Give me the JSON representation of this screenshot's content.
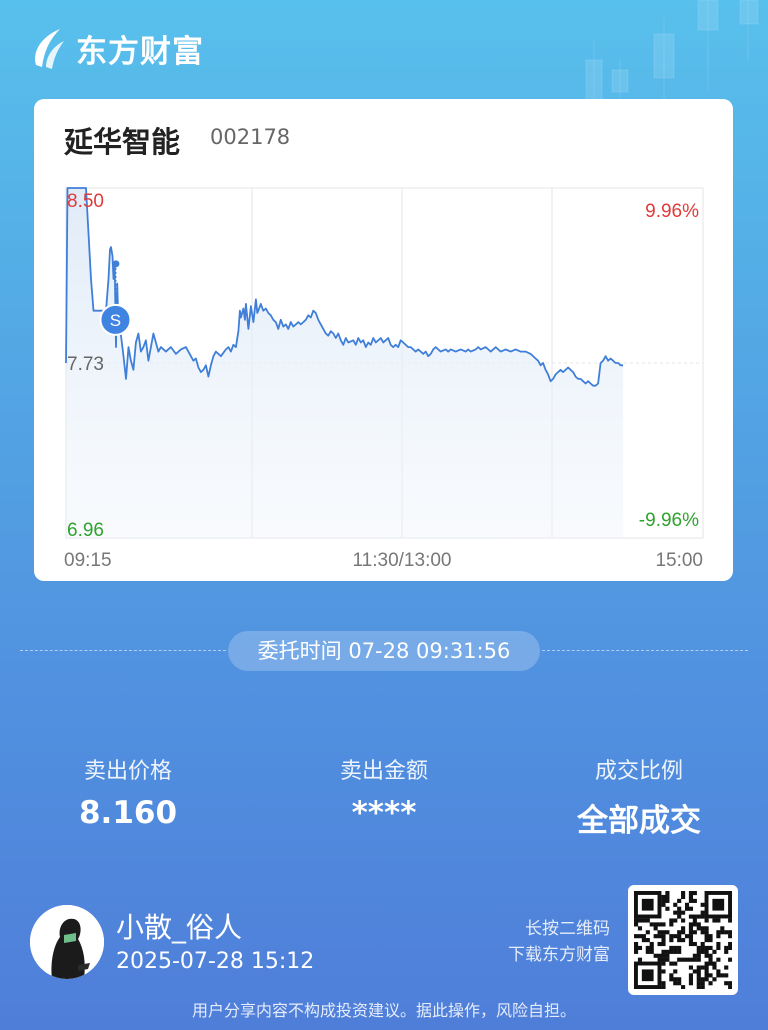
{
  "brand": {
    "name": "东方财富",
    "logo_icon": "eastmoney-logo-icon"
  },
  "stock": {
    "name": "延华智能",
    "code": "002178"
  },
  "chart_data": {
    "type": "line",
    "price_high": "8.50",
    "price_ref": "7.73",
    "price_low": "6.96",
    "pct_high": "9.96%",
    "pct_low": "-9.96%",
    "x_labels": [
      "09:15",
      "11:30/13:00",
      "15:00"
    ],
    "marker_label": "S",
    "ylim": [
      6.96,
      8.5
    ],
    "x_range_minutes": [
      0,
      255
    ],
    "up_color": "#e03b3b",
    "down_color": "#2fa32f",
    "line_color": "#3f7fd8",
    "price_series": [
      [
        0,
        7.73
      ],
      [
        0.6,
        8.5
      ],
      [
        2,
        8.5
      ],
      [
        5,
        8.5
      ],
      [
        8,
        8.5
      ],
      [
        9,
        8.3
      ],
      [
        10,
        8.1
      ],
      [
        11,
        7.96
      ],
      [
        12,
        7.96
      ],
      [
        14,
        7.96
      ],
      [
        15,
        7.96
      ],
      [
        16,
        7.96
      ],
      [
        17,
        8.1
      ],
      [
        17.6,
        8.23
      ],
      [
        18,
        8.24
      ],
      [
        18.6,
        8.2
      ],
      [
        19,
        8.1
      ],
      [
        19.5,
        8.16
      ],
      [
        20,
        7.8
      ],
      [
        20.5,
        8.08
      ],
      [
        21,
        7.9
      ],
      [
        22,
        7.85
      ],
      [
        23,
        7.76
      ],
      [
        24,
        7.66
      ],
      [
        25,
        7.8
      ],
      [
        26,
        7.74
      ],
      [
        27,
        7.7
      ],
      [
        28,
        7.82
      ],
      [
        29,
        7.86
      ],
      [
        30,
        7.78
      ],
      [
        31,
        7.8
      ],
      [
        32,
        7.83
      ],
      [
        33,
        7.74
      ],
      [
        35,
        7.86
      ],
      [
        37,
        7.78
      ],
      [
        38,
        7.8
      ],
      [
        40,
        7.78
      ],
      [
        42,
        7.8
      ],
      [
        44,
        7.77
      ],
      [
        46,
        7.79
      ],
      [
        48,
        7.8
      ],
      [
        49,
        7.78
      ],
      [
        50,
        7.76
      ],
      [
        51,
        7.74
      ],
      [
        52,
        7.75
      ],
      [
        53,
        7.71
      ],
      [
        54,
        7.69
      ],
      [
        55,
        7.7
      ],
      [
        56,
        7.72
      ],
      [
        57,
        7.67
      ],
      [
        58,
        7.72
      ],
      [
        59,
        7.76
      ],
      [
        60,
        7.78
      ],
      [
        62,
        7.76
      ],
      [
        64,
        7.79
      ],
      [
        65,
        7.8
      ],
      [
        66,
        7.78
      ],
      [
        67,
        7.81
      ],
      [
        68,
        7.8
      ],
      [
        69,
        7.87
      ],
      [
        69.6,
        7.96
      ],
      [
        70,
        7.93
      ],
      [
        71,
        7.97
      ],
      [
        71.6,
        7.92
      ],
      [
        72,
        7.99
      ],
      [
        73,
        7.88
      ],
      [
        74,
        7.98
      ],
      [
        75,
        7.91
      ],
      [
        76,
        8.01
      ],
      [
        76.6,
        7.95
      ],
      [
        77,
        7.96
      ],
      [
        78,
        7.99
      ],
      [
        79,
        7.96
      ],
      [
        80,
        7.97
      ],
      [
        81,
        7.95
      ],
      [
        82,
        7.94
      ],
      [
        83,
        7.92
      ],
      [
        84,
        7.91
      ],
      [
        85,
        7.88
      ],
      [
        86,
        7.92
      ],
      [
        87,
        7.89
      ],
      [
        88,
        7.9
      ],
      [
        89,
        7.88
      ],
      [
        90,
        7.91
      ],
      [
        91,
        7.89
      ],
      [
        92,
        7.9
      ],
      [
        93,
        7.91
      ],
      [
        94,
        7.9
      ],
      [
        95,
        7.91
      ],
      [
        96,
        7.92
      ],
      [
        97,
        7.94
      ],
      [
        98,
        7.93
      ],
      [
        99,
        7.96
      ],
      [
        100,
        7.95
      ],
      [
        101,
        7.92
      ],
      [
        102,
        7.9
      ],
      [
        103,
        7.88
      ],
      [
        104,
        7.86
      ],
      [
        105,
        7.85
      ],
      [
        106,
        7.87
      ],
      [
        107,
        7.86
      ],
      [
        108,
        7.84
      ],
      [
        109,
        7.86
      ],
      [
        110,
        7.83
      ],
      [
        111,
        7.81
      ],
      [
        112,
        7.84
      ],
      [
        113,
        7.82
      ],
      [
        115,
        7.83
      ],
      [
        116,
        7.81
      ],
      [
        117,
        7.84
      ],
      [
        118,
        7.82
      ],
      [
        119,
        7.83
      ],
      [
        120,
        7.8
      ],
      [
        121,
        7.82
      ],
      [
        122,
        7.81
      ],
      [
        123,
        7.84
      ],
      [
        124,
        7.82
      ],
      [
        126,
        7.84
      ],
      [
        127,
        7.82
      ],
      [
        128,
        7.83
      ],
      [
        129,
        7.84
      ],
      [
        130,
        7.81
      ],
      [
        131,
        7.8
      ],
      [
        132,
        7.81
      ],
      [
        133,
        7.8
      ],
      [
        134,
        7.83
      ],
      [
        135,
        7.82
      ],
      [
        136,
        7.81
      ],
      [
        137,
        7.8
      ],
      [
        138,
        7.8
      ],
      [
        139,
        7.79
      ],
      [
        140,
        7.78
      ],
      [
        141,
        7.79
      ],
      [
        142,
        7.78
      ],
      [
        143,
        7.77
      ],
      [
        144,
        7.78
      ],
      [
        145,
        7.76
      ],
      [
        146,
        7.77
      ],
      [
        147,
        7.79
      ],
      [
        148,
        7.8
      ],
      [
        149,
        7.79
      ],
      [
        150,
        7.78
      ],
      [
        152,
        7.79
      ],
      [
        153,
        7.78
      ],
      [
        154,
        7.79
      ],
      [
        156,
        7.78
      ],
      [
        158,
        7.79
      ],
      [
        160,
        7.78
      ],
      [
        161,
        7.79
      ],
      [
        162,
        7.78
      ],
      [
        164,
        7.79
      ],
      [
        165,
        7.8
      ],
      [
        166,
        7.79
      ],
      [
        168,
        7.8
      ],
      [
        169,
        7.79
      ],
      [
        170,
        7.78
      ],
      [
        171,
        7.79
      ],
      [
        172,
        7.8
      ],
      [
        173,
        7.79
      ],
      [
        174,
        7.78
      ],
      [
        176,
        7.79
      ],
      [
        178,
        7.78
      ],
      [
        180,
        7.79
      ],
      [
        182,
        7.78
      ],
      [
        184,
        7.78
      ],
      [
        186,
        7.77
      ],
      [
        188,
        7.75
      ],
      [
        189,
        7.74
      ],
      [
        190,
        7.72
      ],
      [
        191,
        7.73
      ],
      [
        192,
        7.7
      ],
      [
        193,
        7.68
      ],
      [
        194,
        7.65
      ],
      [
        195,
        7.66
      ],
      [
        196,
        7.68
      ],
      [
        197,
        7.69
      ],
      [
        198,
        7.7
      ],
      [
        199,
        7.69
      ],
      [
        200,
        7.7
      ],
      [
        201,
        7.71
      ],
      [
        202,
        7.7
      ],
      [
        203,
        7.69
      ],
      [
        204,
        7.67
      ],
      [
        205,
        7.66
      ],
      [
        206,
        7.66
      ],
      [
        207,
        7.65
      ],
      [
        208,
        7.64
      ],
      [
        209,
        7.65
      ],
      [
        210,
        7.64
      ],
      [
        211,
        7.63
      ],
      [
        212,
        7.63
      ],
      [
        213,
        7.64
      ],
      [
        214,
        7.73
      ],
      [
        215,
        7.74
      ],
      [
        216,
        7.76
      ],
      [
        217,
        7.74
      ],
      [
        218,
        7.75
      ],
      [
        219,
        7.74
      ],
      [
        220,
        7.73
      ],
      [
        221,
        7.73
      ],
      [
        222,
        7.72
      ],
      [
        223,
        7.72
      ]
    ],
    "marker_point": [
      20,
      7.92
    ]
  },
  "order": {
    "time_label": "委托时间",
    "time_value": "07-28 09:31:56"
  },
  "stats": [
    {
      "label": "卖出价格",
      "value": "8.160"
    },
    {
      "label": "卖出金额",
      "value": "****"
    },
    {
      "label": "成交比例",
      "value": "全部成交"
    }
  ],
  "user": {
    "name": "小散_俗人",
    "timestamp": "2025-07-28 15:12"
  },
  "qr": {
    "hint_line1": "长按二维码",
    "hint_line2": "下载东方财富"
  },
  "footer": {
    "disclaimer": "用户分享内容不构成投资建议。据此操作，风险自担。"
  }
}
